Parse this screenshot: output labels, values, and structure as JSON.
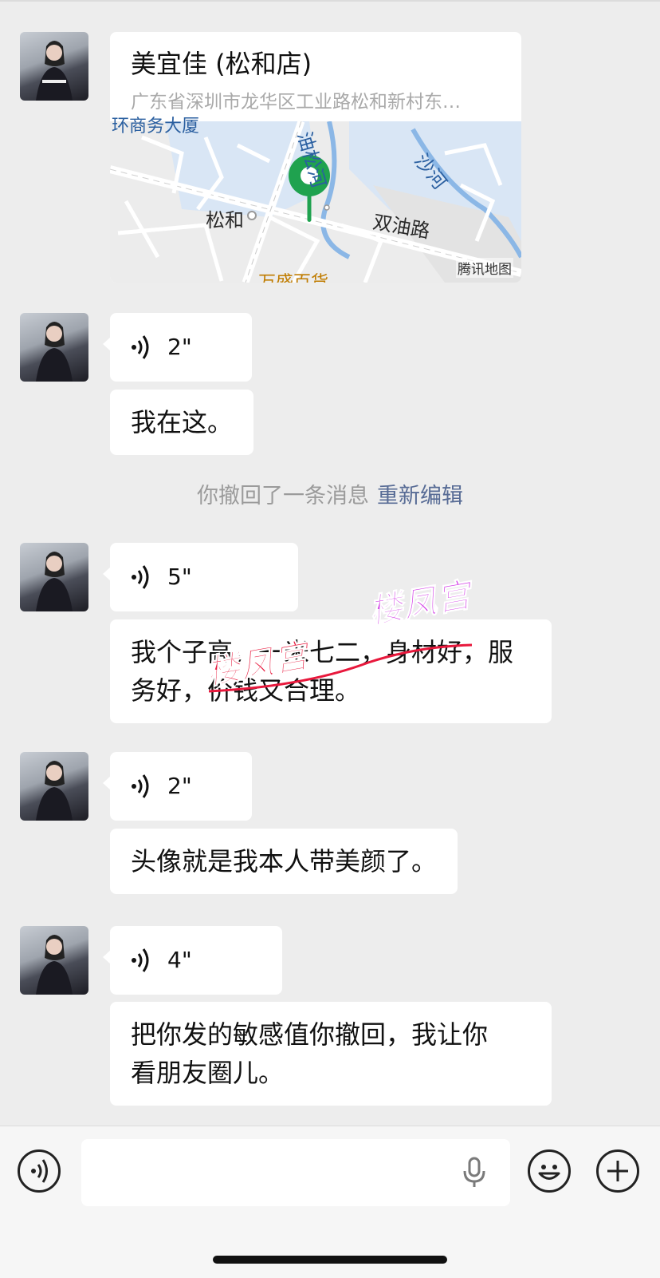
{
  "messages": [
    {
      "type": "location",
      "name": "美宜佳 (松和店)",
      "address": "广东省深圳市龙华区工业路松和新村东…"
    },
    {
      "type": "voice",
      "duration": "2\""
    },
    {
      "type": "text",
      "text": "我在这。"
    },
    {
      "type": "system",
      "text": "你撤回了一条消息",
      "action": "重新编辑"
    },
    {
      "type": "voice",
      "duration": "5\""
    },
    {
      "type": "text",
      "text": "我个子高，一米七二，身材好，服\n务好，价钱又合理。"
    },
    {
      "type": "voice",
      "duration": "2\""
    },
    {
      "type": "text",
      "text": "头像就是我本人带美颜了。"
    },
    {
      "type": "voice",
      "duration": "4\""
    },
    {
      "type": "text",
      "text": "把你发的敏感值你撤回，我让你\n看朋友圈儿。"
    }
  ],
  "map": {
    "labels": {
      "place": "松和",
      "road": "双油路",
      "river1": "油松河",
      "river2": "沙河",
      "poi": "万盛百货",
      "top_cut": "环商务大厦"
    },
    "credit": "腾讯地图"
  },
  "watermark": {
    "text": "楼凤宫",
    "colors": [
      "#e8183c",
      "#d23ae6"
    ]
  },
  "icons": [
    "voice-input-icon",
    "microphone-icon",
    "emoji-icon",
    "plus-icon",
    "voice-wave-icon",
    "location-pin-icon"
  ]
}
